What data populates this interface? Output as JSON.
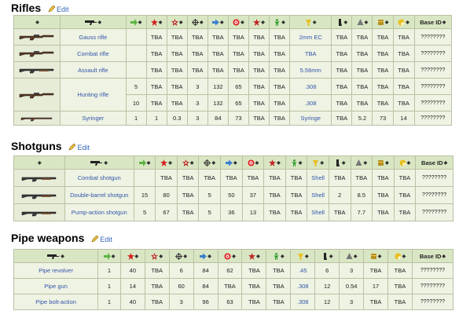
{
  "sections": {
    "rifles": {
      "title": "Rifles",
      "edit": "Edit"
    },
    "shotguns": {
      "title": "Shotguns",
      "edit": "Edit"
    },
    "pipe": {
      "title": "Pipe weapons",
      "edit": "Edit"
    }
  },
  "header": {
    "sort": "◆",
    "base_id": "Base ID"
  },
  "icons": [
    "weapon-type-icon",
    "ammo-icon",
    "damage-icon",
    "crit-damage-icon",
    "spread-icon",
    "speed-icon",
    "ap-icon",
    "crit-chance-icon",
    "strength-icon",
    "weight-icon",
    "ammo-type-icon",
    "magazine-icon",
    "value-icon",
    "durability-icon",
    "ammo-cap-icon",
    "weapon-health-icon"
  ],
  "rifles": {
    "rows": [
      {
        "name": "Gauss rifle",
        "c": [
          "",
          "TBA",
          "TBA",
          "TBA",
          "TBA",
          "TBA",
          "TBA",
          "TBA",
          "2mm EC",
          "TBA",
          "TBA",
          "TBA",
          "TBA"
        ],
        "id": "????????"
      },
      {
        "name": "Combat rifle",
        "c": [
          "",
          "TBA",
          "TBA",
          "TBA",
          "TBA",
          "TBA",
          "TBA",
          "TBA",
          "TBA",
          "TBA",
          "TBA",
          "TBA",
          "TBA"
        ],
        "id": "????????"
      },
      {
        "name": "Assault rifle",
        "c": [
          "",
          "TBA",
          "TBA",
          "TBA",
          "TBA",
          "TBA",
          "TBA",
          "TBA",
          "5.56mm",
          "TBA",
          "TBA",
          "TBA",
          "TBA"
        ],
        "id": "????????"
      },
      {
        "name": "Hunting rifle",
        "c": [
          "5",
          "TBA",
          "TBA",
          "3",
          "132",
          "65",
          "TBA",
          "TBA",
          ".308",
          "TBA",
          "TBA",
          "TBA",
          "TBA"
        ],
        "id": "????????"
      },
      {
        "name": "",
        "c": [
          "10",
          "TBA",
          "TBA",
          "3",
          "132",
          "65",
          "TBA",
          "TBA",
          ".308",
          "TBA",
          "TBA",
          "TBA",
          "TBA"
        ],
        "id": "????????"
      },
      {
        "name": "Syringer",
        "c": [
          "1",
          "1",
          "0.3",
          "3",
          "84",
          "73",
          "TBA",
          "TBA",
          "Syringe",
          "TBA",
          "5.2",
          "73",
          "14"
        ],
        "id": "????????"
      }
    ]
  },
  "shotguns": {
    "rows": [
      {
        "name": "Combat shotgun",
        "c": [
          "",
          "TBA",
          "TBA",
          "TBA",
          "TBA",
          "TBA",
          "TBA",
          "TBA",
          "Shell",
          "TBA",
          "TBA",
          "TBA",
          "TBA"
        ],
        "id": "????????"
      },
      {
        "name": "Double-barrel shotgun",
        "c": [
          "15",
          "80",
          "TBA",
          "5",
          "50",
          "37",
          "TBA",
          "TBA",
          "Shell",
          "2",
          "8.5",
          "TBA",
          "TBA"
        ],
        "id": "????????"
      },
      {
        "name": "Pump-action shotgun",
        "c": [
          "5",
          "67",
          "TBA",
          "5",
          "36",
          "13",
          "TBA",
          "TBA",
          "Shell",
          "TBA",
          "7.7",
          "TBA",
          "TBA"
        ],
        "id": "????????"
      }
    ]
  },
  "pipe": {
    "rows": [
      {
        "name": "Pipe revolver",
        "c": [
          "1",
          "40",
          "TBA",
          "6",
          "84",
          "62",
          "TBA",
          "TBA",
          ".45",
          "6",
          "3",
          "TBA",
          "TBA"
        ],
        "id": "????????"
      },
      {
        "name": "Pipe gun",
        "c": [
          "1",
          "14",
          "TBA",
          "60",
          "84",
          "TBA",
          "TBA",
          "TBA",
          ".308",
          "12",
          "0.54",
          "17",
          "TBA"
        ],
        "id": "????????"
      },
      {
        "name": "Pipe bolt-action",
        "c": [
          "1",
          "40",
          "TBA",
          "3",
          "96",
          "63",
          "TBA",
          "TBA",
          ".308",
          "12",
          "3",
          "TBA",
          "TBA"
        ],
        "id": "????????"
      }
    ]
  }
}
